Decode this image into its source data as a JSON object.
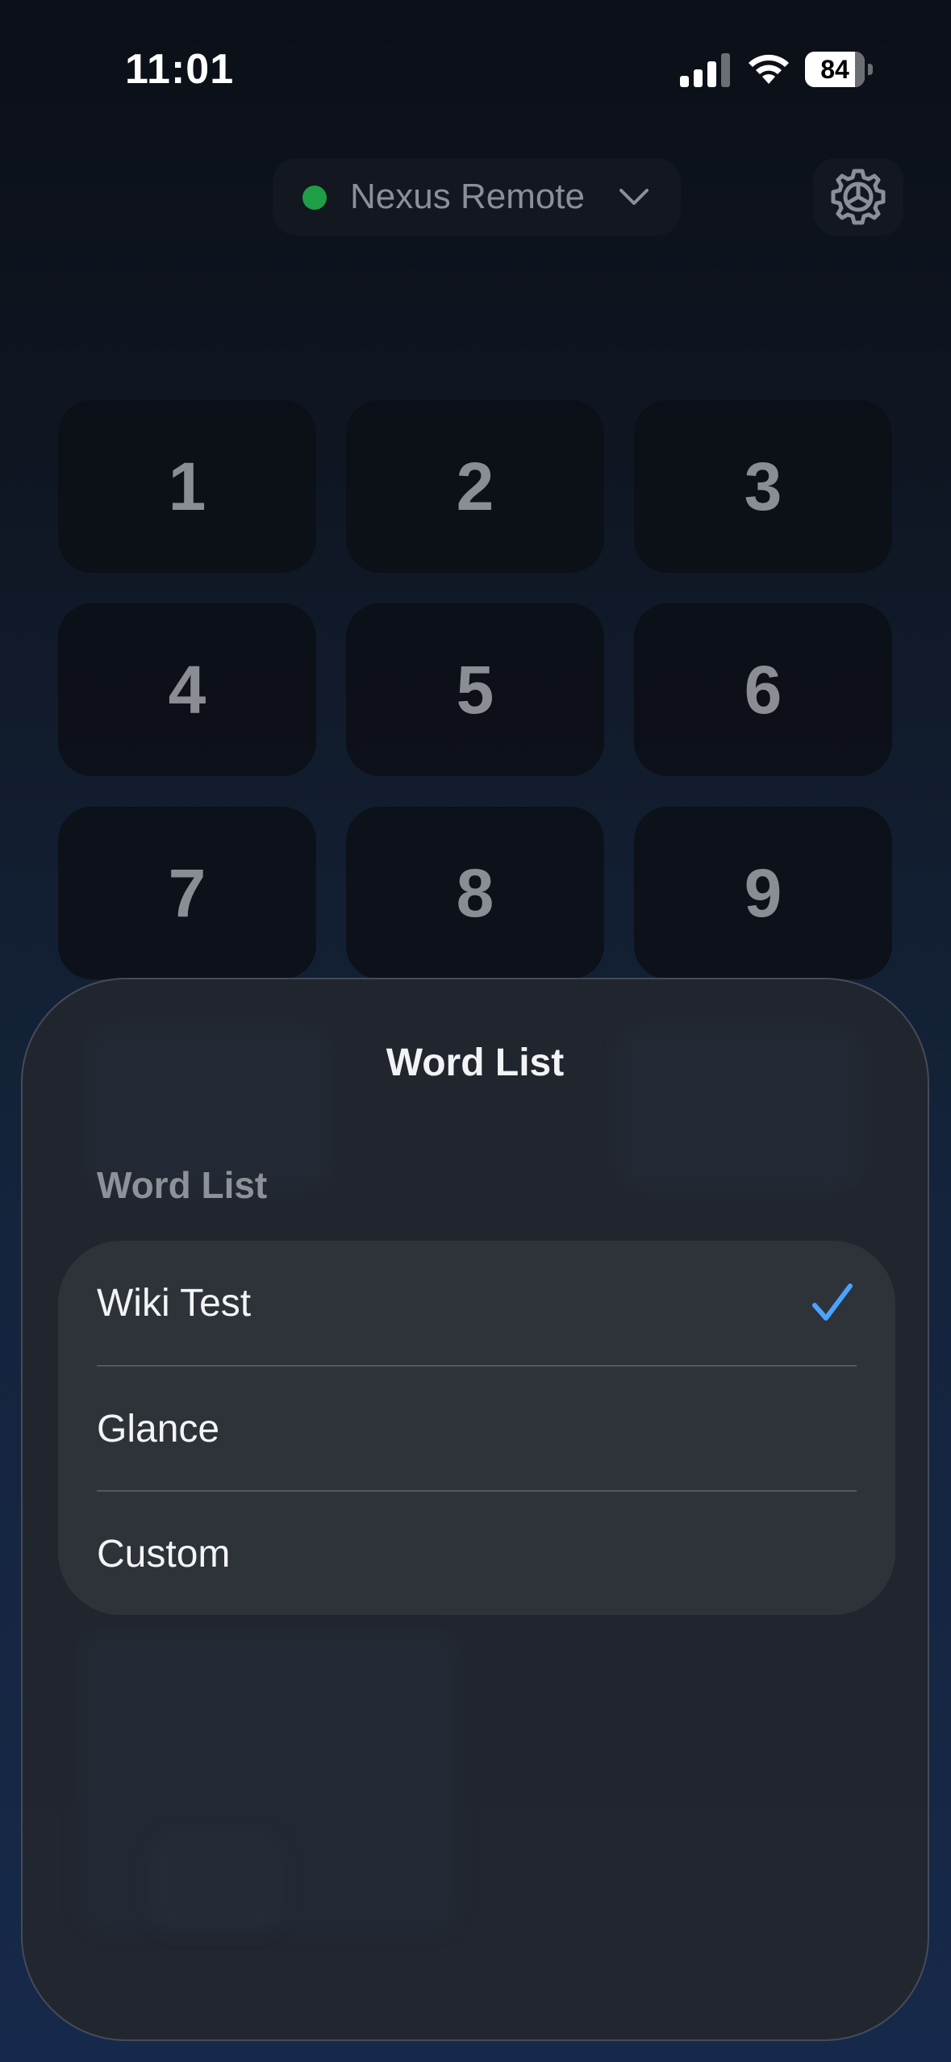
{
  "status_bar": {
    "time": "11:01",
    "battery_level": "84",
    "battery_fraction": 0.84
  },
  "header": {
    "device_name": "Nexus Remote",
    "status_color": "#1e9e45",
    "icons": [
      "chevron-down-icon",
      "gear-icon"
    ]
  },
  "keypad": {
    "keys": [
      "1",
      "2",
      "3",
      "4",
      "5",
      "6",
      "7",
      "8",
      "9"
    ]
  },
  "sheet": {
    "title": "Word List",
    "section_header": "Word List",
    "options": [
      {
        "label": "Wiki Test",
        "selected": true
      },
      {
        "label": "Glance",
        "selected": false
      },
      {
        "label": "Custom",
        "selected": false
      }
    ],
    "accent_color": "#4aa3ff"
  }
}
